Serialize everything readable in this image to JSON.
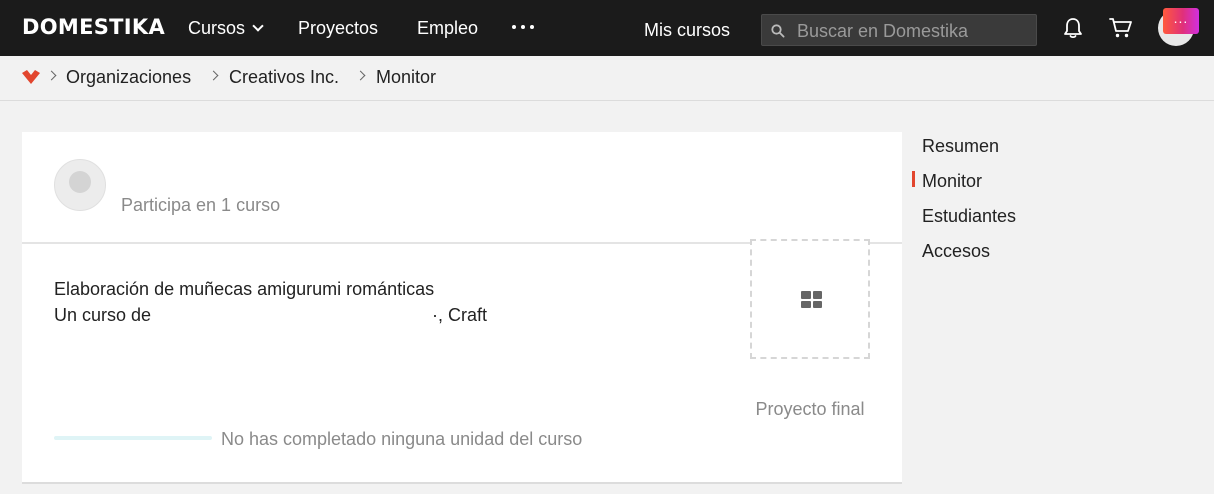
{
  "header": {
    "logo_text": "DOMESTIKA",
    "nav": {
      "cursos": "Cursos",
      "proyectos": "Proyectos",
      "empleo": "Empleo",
      "mis_cursos": "Mis cursos"
    },
    "search": {
      "placeholder": "Buscar en Domestika",
      "value": ""
    },
    "notification_badge": "..."
  },
  "breadcrumb": {
    "items": [
      "Organizaciones",
      "Creativos Inc.",
      "Monitor"
    ]
  },
  "student": {
    "participation": "Participa en 1 curso"
  },
  "course": {
    "title": "Elaboración de muñecas amigurumi románticas",
    "author_prefix": "Un curso de",
    "author_suffix": "·, Craft",
    "progress_fraction": 0,
    "progress_text": "No has completado ninguna unidad del curso",
    "project_label": "Proyecto final"
  },
  "sidebar": {
    "items": [
      "Resumen",
      "Monitor",
      "Estudiantes",
      "Accesos"
    ],
    "active_index": 1
  },
  "colors": {
    "topbar": "#1b1b1b",
    "accent": "#e2462e",
    "progress_track": "#dff4f6",
    "page_bg": "#f2f2f2"
  }
}
